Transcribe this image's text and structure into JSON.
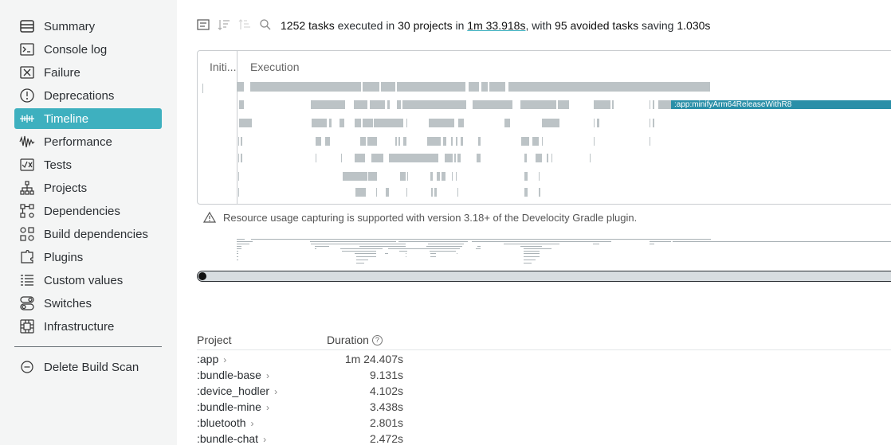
{
  "sidebar": {
    "items": [
      {
        "label": "Summary",
        "icon": "summary-icon"
      },
      {
        "label": "Console log",
        "icon": "console-icon"
      },
      {
        "label": "Failure",
        "icon": "failure-icon"
      },
      {
        "label": "Deprecations",
        "icon": "deprecations-icon"
      },
      {
        "label": "Timeline",
        "icon": "timeline-icon",
        "active": true
      },
      {
        "label": "Performance",
        "icon": "performance-icon"
      },
      {
        "label": "Tests",
        "icon": "tests-icon"
      },
      {
        "label": "Projects",
        "icon": "projects-icon"
      },
      {
        "label": "Dependencies",
        "icon": "dependencies-icon"
      },
      {
        "label": "Build dependencies",
        "icon": "build-dependencies-icon"
      },
      {
        "label": "Plugins",
        "icon": "plugins-icon"
      },
      {
        "label": "Custom values",
        "icon": "custom-values-icon"
      },
      {
        "label": "Switches",
        "icon": "switches-icon"
      },
      {
        "label": "Infrastructure",
        "icon": "infrastructure-icon"
      }
    ],
    "delete_label": "Delete Build Scan"
  },
  "summary": {
    "tasks": "1252 tasks",
    "t1": " executed in ",
    "projects": "30 projects",
    "t2": " in ",
    "time": "1m 33.918s",
    "t3": ", with ",
    "avoided": "95 avoided tasks",
    "t4": " saving ",
    "saving": "1.030s"
  },
  "timeline": {
    "init_header": "Initi...",
    "exec_header": "Execution",
    "highlight_task": ":app:minifyArm64ReleaseWithR8"
  },
  "warning": "Resource usage capturing is supported with version 3.18+ of the Develocity Gradle plugin.",
  "table": {
    "col_project": "Project",
    "col_duration": "Duration",
    "help": "?",
    "rows": [
      {
        "project": ":app",
        "duration": "1m 24.407s"
      },
      {
        "project": ":bundle-base",
        "duration": "9.131s"
      },
      {
        "project": ":device_hodler",
        "duration": "4.102s"
      },
      {
        "project": ":bundle-mine",
        "duration": "3.438s"
      },
      {
        "project": ":bluetooth",
        "duration": "2.801s"
      },
      {
        "project": ":bundle-chat",
        "duration": "2.472s"
      }
    ],
    "chevron": "›"
  },
  "colors": {
    "accent": "#3eb0bf",
    "bar": "#bcc3c6",
    "highlight": "#2a8fa8"
  }
}
